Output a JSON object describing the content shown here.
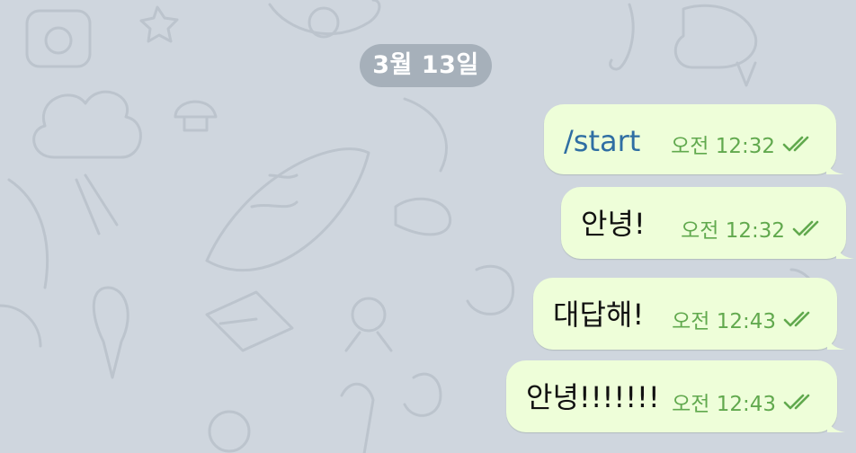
{
  "date_label": "3월 13일",
  "colors": {
    "background": "#cfd6de",
    "bubble": "#eefed9",
    "time_text": "#61a94e",
    "command_link": "#2f6ea3",
    "date_pill": "#a6b0ba"
  },
  "messages": [
    {
      "text": "/start",
      "time": "오전 12:32",
      "status_icon": "double-check-icon"
    },
    {
      "text": "안녕!",
      "time": "오전 12:32",
      "status_icon": "double-check-icon"
    },
    {
      "text": "대답해!",
      "time": "오전 12:43",
      "status_icon": "double-check-icon"
    },
    {
      "text": "안녕!!!!!!!",
      "time": "오전 12:43",
      "status_icon": "double-check-icon"
    }
  ]
}
